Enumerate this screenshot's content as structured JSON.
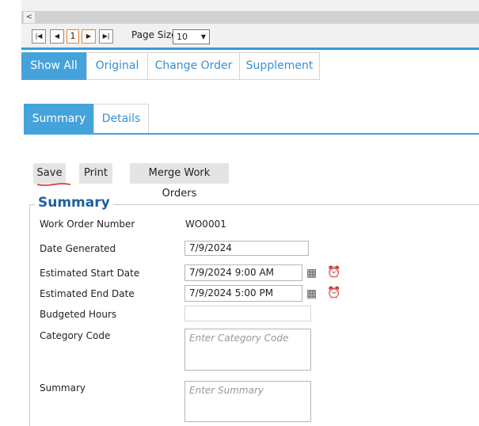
{
  "pager": {
    "scroll_left": "<",
    "first": "|◀",
    "prev": "◀",
    "current_page": "1",
    "next": "▶",
    "last": "▶|",
    "page_size_label": "Page Size",
    "page_size_value": "10"
  },
  "filter_tabs": [
    {
      "label": "Show All",
      "active": true
    },
    {
      "label": "Original",
      "active": false
    },
    {
      "label": "Change Order",
      "active": false
    },
    {
      "label": "Supplement",
      "active": false
    }
  ],
  "section_tabs": [
    {
      "label": "Summary",
      "active": true
    },
    {
      "label": "Details",
      "active": false
    }
  ],
  "actions": {
    "save": "Save",
    "print": "Print",
    "merge": "Merge Work Orders"
  },
  "form": {
    "legend": "Summary",
    "work_order_number_label": "Work Order Number",
    "work_order_number_value": "WO0001",
    "date_generated_label": "Date Generated",
    "date_generated_value": "7/9/2024",
    "est_start_label": "Estimated Start Date",
    "est_start_value": "7/9/2024 9:00 AM",
    "est_end_label": "Estimated End Date",
    "est_end_value": "7/9/2024 5:00 PM",
    "budgeted_hours_label": "Budgeted Hours",
    "budgeted_hours_value": "",
    "category_code_label": "Category Code",
    "category_code_placeholder": "Enter Category Code",
    "summary_label": "Summary",
    "summary_placeholder": "Enter Summary"
  },
  "icons": {
    "calendar": "calendar-icon",
    "clock": "clock-icon"
  },
  "colors": {
    "accent": "#45a3dc",
    "legend": "#1f5f9e",
    "active_page_border": "#e68a2e",
    "save_underline": "#d92020"
  }
}
